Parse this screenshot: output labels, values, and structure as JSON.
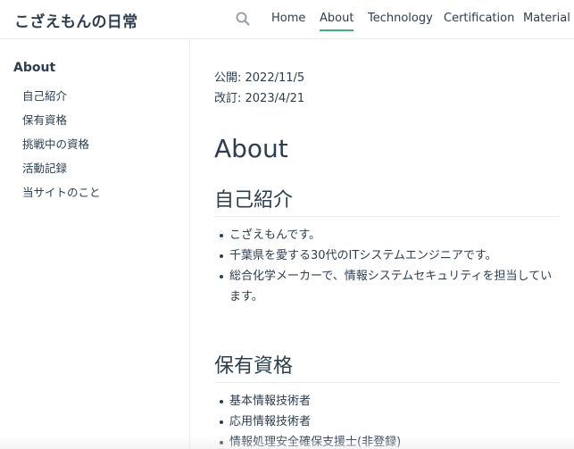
{
  "header": {
    "site_title": "こざえもんの日常",
    "search_icon": "search-icon",
    "nav": [
      {
        "label": "Home"
      },
      {
        "label": "About"
      },
      {
        "label": "Technology"
      },
      {
        "label": "Certification"
      },
      {
        "label": "Material"
      }
    ],
    "accent_color": "#3eaf7c"
  },
  "sidebar": {
    "heading": "About",
    "items": [
      {
        "label": "自己紹介"
      },
      {
        "label": "保有資格"
      },
      {
        "label": "挑戦中の資格"
      },
      {
        "label": "活動記録"
      },
      {
        "label": "当サイトのこと"
      }
    ]
  },
  "content": {
    "published": "公開: 2022/11/5",
    "revised": "改訂: 2023/4/21",
    "title": "About",
    "sections": [
      {
        "heading": "自己紹介",
        "items": [
          "こざえもんです。",
          "千葉県を愛する30代のITシステムエンジニアです。",
          "総合化学メーカーで、情報システムセキュリティを担当しています。"
        ]
      },
      {
        "heading": "保有資格",
        "items": [
          "基本情報技術者",
          "応用情報技術者",
          "情報処理安全確保支援士(非登録)"
        ]
      }
    ]
  }
}
